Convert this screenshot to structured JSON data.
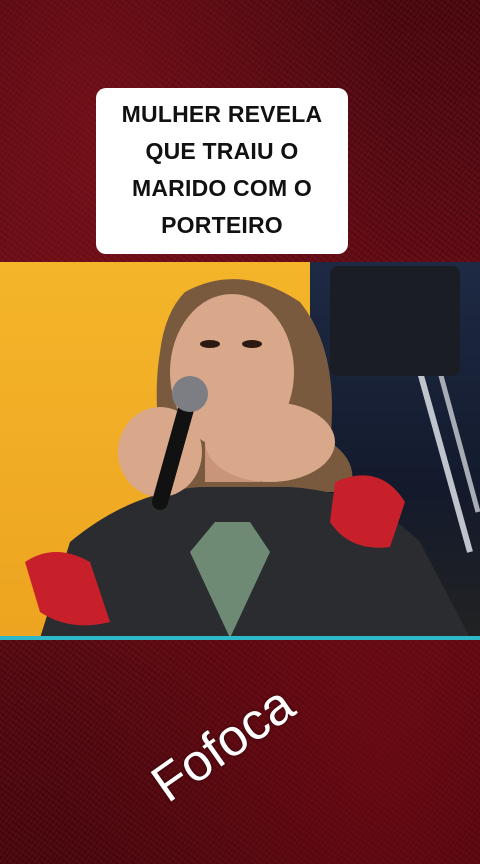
{
  "caption": {
    "lines": [
      "MULHER REVELA",
      "QUE TRAIU O",
      "MARIDO COM O",
      "PORTEIRO"
    ]
  },
  "video": {
    "description_icon": "video-frame"
  },
  "watermark": {
    "text": "Fofoca"
  },
  "colors": {
    "background": "#5a0a12",
    "caption_bg": "#ffffff",
    "accent_line": "#2fb8c8",
    "wall": "#f2b324"
  }
}
